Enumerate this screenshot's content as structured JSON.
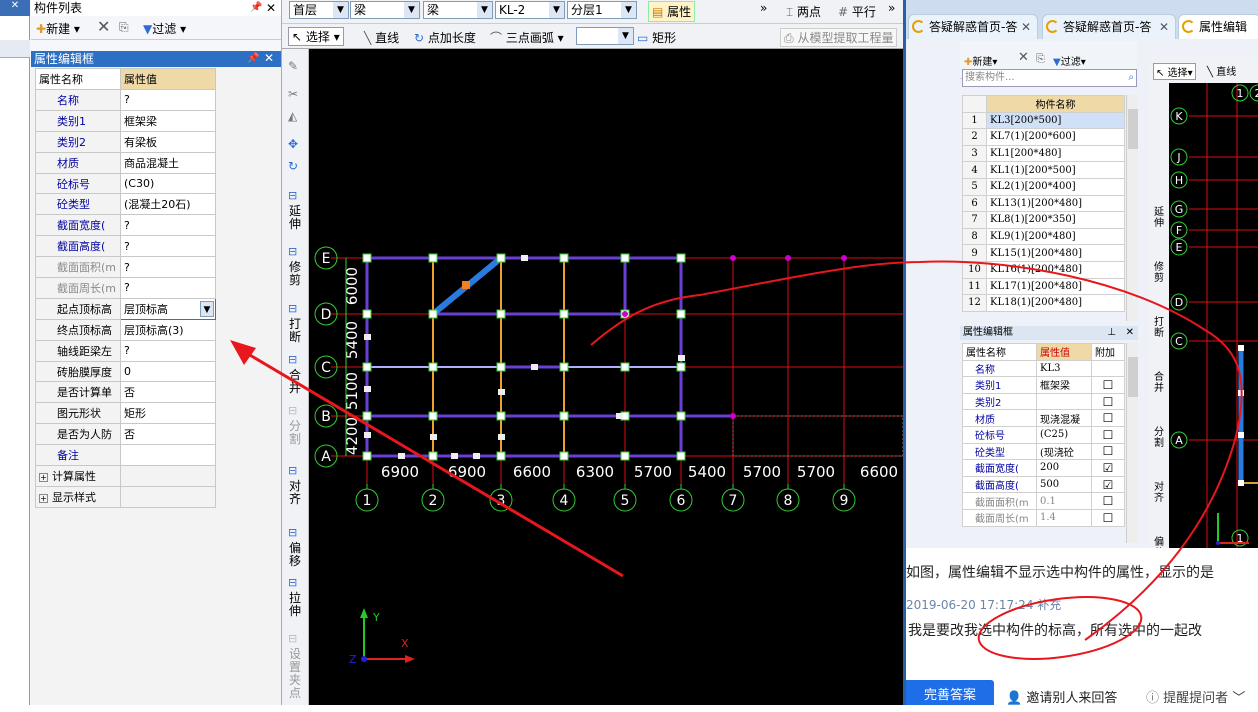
{
  "left_panel": {
    "component_list_title": "构件列表",
    "new_label": "新建",
    "filter_label": "过滤",
    "prop_editor_title": "属性编辑框",
    "header_name": "属性名称",
    "header_value": "属性值",
    "props": [
      {
        "name": "名称",
        "value": "?"
      },
      {
        "name": "类别1",
        "value": "框架梁"
      },
      {
        "name": "类别2",
        "value": "有梁板"
      },
      {
        "name": "材质",
        "value": "商品混凝土"
      },
      {
        "name": "砼标号",
        "value": "(C30)"
      },
      {
        "name": "砼类型",
        "value": "(混凝土20石)"
      },
      {
        "name": "截面宽度(",
        "value": "?"
      },
      {
        "name": "截面高度(",
        "value": "?"
      },
      {
        "name": "截面面积(m",
        "value": "?"
      },
      {
        "name": "截面周长(m",
        "value": "?"
      },
      {
        "name": "起点顶标高",
        "value": "层顶标高"
      },
      {
        "name": "终点顶标高",
        "value": "层顶标高(3)"
      },
      {
        "name": "轴线距梁左",
        "value": "?"
      },
      {
        "name": "砖胎膜厚度",
        "value": "0"
      },
      {
        "name": "是否计算单",
        "value": "否"
      },
      {
        "name": "图元形状",
        "value": "矩形"
      },
      {
        "name": "是否为人防",
        "value": "否"
      },
      {
        "name": "备注",
        "value": ""
      },
      {
        "name": "计算属性",
        "value": ""
      },
      {
        "name": "显示样式",
        "value": ""
      }
    ]
  },
  "toolbar": {
    "floor": "首层",
    "type1": "梁",
    "type2": "梁",
    "comp": "KL-2",
    "layer": "分层1",
    "props_btn": "属性",
    "more1": "»",
    "more2": "»",
    "twopoint": "两点",
    "parallel": "平行",
    "select": "选择",
    "line": "直线",
    "pointlen": "点加长度",
    "arc3": "三点画弧",
    "rect": "矩形",
    "extract": "从模型提取工程量"
  },
  "vtools": [
    {
      "label": "延伸"
    },
    {
      "label": "修剪"
    },
    {
      "label": "打断"
    },
    {
      "label": "合并"
    },
    {
      "label": "分割"
    },
    {
      "label": "对齐"
    },
    {
      "label": "偏移"
    },
    {
      "label": "拉伸"
    },
    {
      "label": "设置夹点"
    }
  ],
  "cad": {
    "axis_rows": [
      "E",
      "D",
      "C",
      "B",
      "A"
    ],
    "axis_cols": [
      "1",
      "2",
      "3",
      "4",
      "5",
      "6",
      "7",
      "8",
      "9"
    ],
    "row_dims": [
      "6000",
      "5400",
      "5100",
      "4200"
    ],
    "col_dims": [
      "6900",
      "6900",
      "6600",
      "6300",
      "5700",
      "5400",
      "5700",
      "5700",
      "6600"
    ],
    "ucs_y": "Y",
    "ucs_x": "X",
    "ucs_z": "Z"
  },
  "browser": {
    "tabs": [
      {
        "label": "答疑解惑首页-答"
      },
      {
        "label": "答疑解惑首页-答"
      },
      {
        "label": "属性编辑"
      }
    ],
    "inner": {
      "new_label": "新建",
      "filter_label": "过滤",
      "search_placeholder": "搜索构件...",
      "list_header": "构件名称",
      "list": [
        {
          "idx": "1",
          "name": "KL3[200*500]"
        },
        {
          "idx": "2",
          "name": "KL7(1)[200*600]"
        },
        {
          "idx": "3",
          "name": "KL1[200*480]"
        },
        {
          "idx": "4",
          "name": "KL1(1)[200*500]"
        },
        {
          "idx": "5",
          "name": "KL2(1)[200*400]"
        },
        {
          "idx": "6",
          "name": "KL13(1)[200*480]"
        },
        {
          "idx": "7",
          "name": "KL8(1)[200*350]"
        },
        {
          "idx": "8",
          "name": "KL9(1)[200*480]"
        },
        {
          "idx": "9",
          "name": "KL15(1)[200*480]"
        },
        {
          "idx": "10",
          "name": "KL16(1)[200*480]"
        },
        {
          "idx": "11",
          "name": "KL17(1)[200*480]"
        },
        {
          "idx": "12",
          "name": "KL18(1)[200*480]"
        }
      ],
      "prop_title": "属性编辑框",
      "h_name": "属性名称",
      "h_value": "属性值",
      "h_add": "附加",
      "props": [
        {
          "name": "名称",
          "value": "KL3",
          "chk": ""
        },
        {
          "name": "类别1",
          "value": "框架梁",
          "chk": "☐"
        },
        {
          "name": "类别2",
          "value": "",
          "chk": "☐"
        },
        {
          "name": "材质",
          "value": "现浇混凝",
          "chk": "☐"
        },
        {
          "name": "砼标号",
          "value": "(C25)",
          "chk": "☐"
        },
        {
          "name": "砼类型",
          "value": "(现浇砼",
          "chk": "☐"
        },
        {
          "name": "截面宽度(",
          "value": "200",
          "chk": "☑"
        },
        {
          "name": "截面高度(",
          "value": "500",
          "chk": "☑"
        },
        {
          "name": "截面面积(m",
          "value": "0.1",
          "chk": "☐"
        },
        {
          "name": "截面周长(m",
          "value": "1.4",
          "chk": "☐"
        }
      ],
      "select": "选择",
      "line": "直线",
      "vtools": [
        "延伸",
        "修剪",
        "打断",
        "合并",
        "分割",
        "对齐",
        "偏移"
      ],
      "axis_labels": [
        "K",
        "J",
        "H",
        "G",
        "F",
        "E",
        "D",
        "C",
        "A"
      ],
      "top_axis": [
        "1",
        "2"
      ],
      "bottom_axis": "1"
    },
    "question_text": "如图，属性编辑不显示选中构件的属性，显示的是",
    "timestamp": "2019-06-20 17:17:24 补充",
    "supplement": "我是要改我选中构件的标高，所有选中的一起改",
    "complete_btn": "完善答案",
    "invite_btn": "邀请别人来回答",
    "remind_btn": "提醒提问者"
  },
  "colors": {
    "annotation": "#e8171d",
    "cad_bg": "#000000",
    "beam": "#6a3fd6"
  }
}
